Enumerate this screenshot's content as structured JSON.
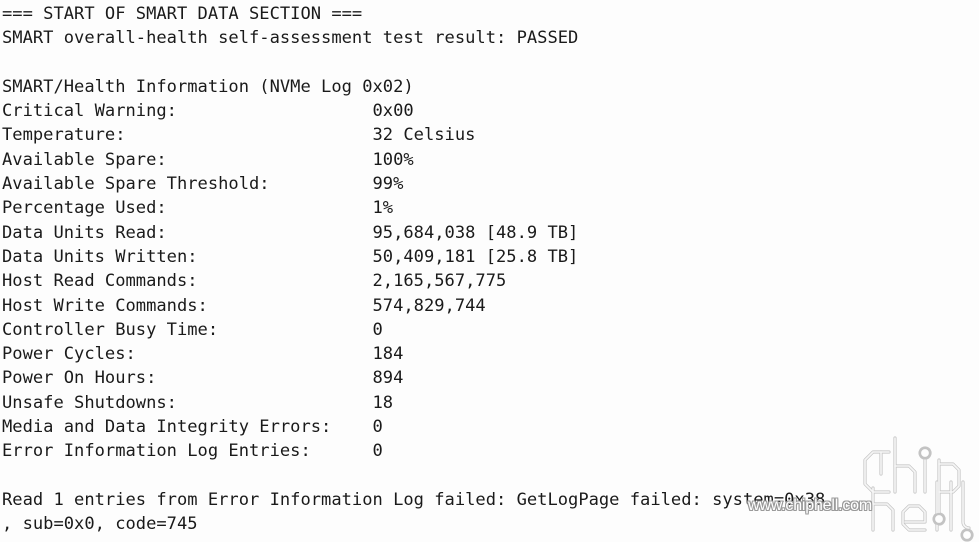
{
  "terminal": {
    "background_color": "#fdfdfd",
    "text_color": "#1a1a1a",
    "lines": [
      "=== START OF SMART DATA SECTION ===",
      "SMART overall-health self-assessment test result: PASSED",
      "",
      "SMART/Health Information (NVMe Log 0x02)",
      "Critical Warning:                   0x00",
      "Temperature:                        32 Celsius",
      "Available Spare:                    100%",
      "Available Spare Threshold:          99%",
      "Percentage Used:                    1%",
      "Data Units Read:                    95,684,038 [48.9 TB]",
      "Data Units Written:                 50,409,181 [25.8 TB]",
      "Host Read Commands:                 2,165,567,775",
      "Host Write Commands:                574,829,744",
      "Controller Busy Time:               0",
      "Power Cycles:                       184",
      "Power On Hours:                     894",
      "Unsafe Shutdowns:                   18",
      "Media and Data Integrity Errors:    0",
      "Error Information Log Entries:      0",
      "",
      "Read 1 entries from Error Information Log failed: GetLogPage failed: system=0x38",
      ", sub=0x0, code=745"
    ],
    "section_header": "=== START OF SMART DATA SECTION ===",
    "health_result_label": "SMART overall-health self-assessment test result:",
    "health_result_value": "PASSED",
    "info_header": "SMART/Health Information (NVMe Log 0x02)",
    "attributes": [
      {
        "label": "Critical Warning:",
        "value": "0x00"
      },
      {
        "label": "Temperature:",
        "value": "32 Celsius"
      },
      {
        "label": "Available Spare:",
        "value": "100%"
      },
      {
        "label": "Available Spare Threshold:",
        "value": "99%"
      },
      {
        "label": "Percentage Used:",
        "value": "1%"
      },
      {
        "label": "Data Units Read:",
        "value": "95,684,038 [48.9 TB]"
      },
      {
        "label": "Data Units Written:",
        "value": "50,409,181 [25.8 TB]"
      },
      {
        "label": "Host Read Commands:",
        "value": "2,165,567,775"
      },
      {
        "label": "Host Write Commands:",
        "value": "574,829,744"
      },
      {
        "label": "Controller Busy Time:",
        "value": "0"
      },
      {
        "label": "Power Cycles:",
        "value": "184"
      },
      {
        "label": "Power On Hours:",
        "value": "894"
      },
      {
        "label": "Unsafe Shutdowns:",
        "value": "18"
      },
      {
        "label": "Media and Data Integrity Errors:",
        "value": "0"
      },
      {
        "label": "Error Information Log Entries:",
        "value": "0"
      }
    ],
    "error_message_line1": "Read 1 entries from Error Information Log failed: GetLogPage failed: system=0x38",
    "error_message_line2": ", sub=0x0, code=745"
  },
  "watermark": {
    "logo_name": "chiphell-logo",
    "url_text": "www.chiphell.com",
    "outline_color": "#9a9a9a",
    "fill_color": "#ffffff"
  }
}
